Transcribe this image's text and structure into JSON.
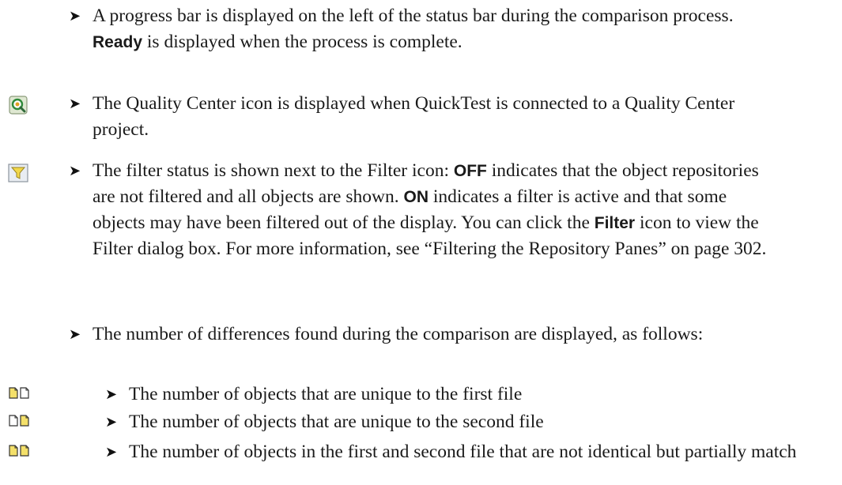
{
  "items": [
    {
      "parts": [
        {
          "t": "A progress bar is displayed on the left of the status bar during the comparison process. "
        },
        {
          "t": "Ready",
          "b": true
        },
        {
          "t": " is displayed when the process is complete."
        }
      ]
    },
    {
      "icon": "quality-center-icon",
      "parts": [
        {
          "t": "The Quality Center icon is displayed when QuickTest is connected to a Quality Center project."
        }
      ]
    },
    {
      "icon": "filter-icon",
      "parts": [
        {
          "t": "The filter status is shown next to the Filter icon: "
        },
        {
          "t": "OFF",
          "b": true
        },
        {
          "t": " indicates that the object repositories are not filtered and all objects are shown. "
        },
        {
          "t": "ON",
          "b": true
        },
        {
          "t": " indicates a filter is active and that some objects may have been filtered out of the display. You can click the "
        },
        {
          "t": "Filter",
          "b": true
        },
        {
          "t": " icon to view the Filter dialog box. For more information, see “Filtering the Repository Panes” on page 302."
        }
      ]
    },
    {
      "parts": [
        {
          "t": "The number of differences found during the comparison are displayed, as follows:"
        }
      ]
    }
  ],
  "subitems": [
    {
      "icon": "unique-first-file-icon",
      "text": "The number of objects that are unique to the first file"
    },
    {
      "icon": "unique-second-file-icon",
      "text": "The number of objects that are unique to the second file"
    },
    {
      "icon": "partial-match-icon",
      "text": "The number of objects in the first and second file that are not identical but partially match"
    }
  ],
  "bullet_glyph": "➤"
}
